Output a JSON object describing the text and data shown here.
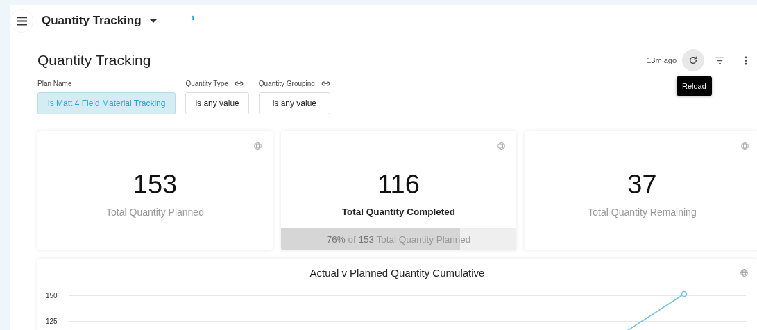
{
  "header": {
    "title": "Quantity Tracking"
  },
  "dashboard": {
    "title": "Quantity Tracking",
    "updated": "13m ago",
    "reload_hovered": true,
    "tooltip": "Reload"
  },
  "filters": [
    {
      "label": "Plan Name",
      "linked": false,
      "value": "is Matt 4 Field Material Tracking",
      "selected": true
    },
    {
      "label": "Quantity Type",
      "linked": true,
      "value": "is any value",
      "selected": false
    },
    {
      "label": "Quantity Grouping",
      "linked": true,
      "value": "is any value",
      "selected": false
    }
  ],
  "tiles": [
    {
      "kind": "plain",
      "value": "153",
      "label": "Total Quantity Planned"
    },
    {
      "kind": "progress",
      "value": "116",
      "label": "Total Quantity Completed",
      "progress": {
        "text": "**76%** of **153** Total Quantity Planned",
        "level": 0.76
      }
    },
    {
      "kind": "plain",
      "value": "37",
      "label": "Total Quantity Remaining"
    }
  ],
  "chart": {
    "title": "Actual v Planned Quantity Cumulative",
    "y_tick_labels": [
      "150",
      "125"
    ]
  }
}
